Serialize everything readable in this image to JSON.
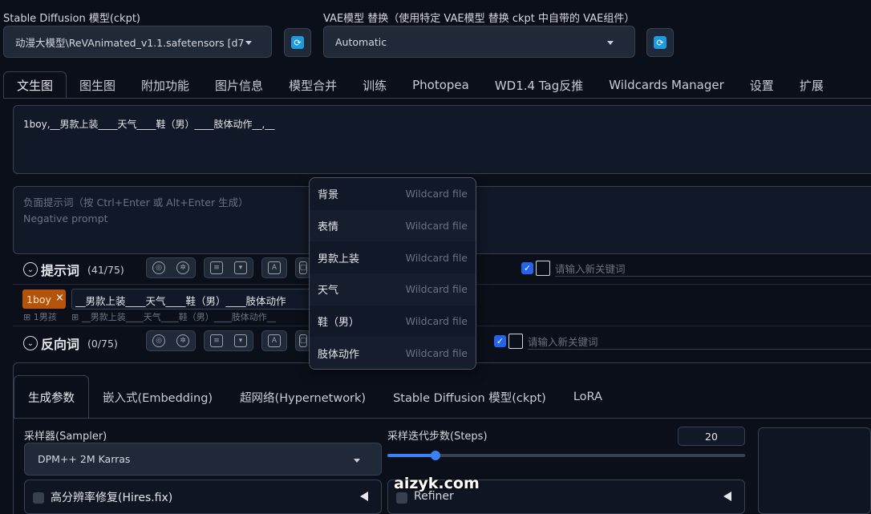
{
  "model": {
    "label": "Stable Diffusion 模型(ckpt)",
    "value": "动漫大模型\\ReVAnimated_v1.1.safetensors [d7"
  },
  "vae": {
    "label": "VAE模型 替换（使用特定 VAE模型 替换 ckpt 中自带的 VAE组件）",
    "value": "Automatic"
  },
  "tabs": [
    "文生图",
    "图生图",
    "附加功能",
    "图片信息",
    "模型合并",
    "训练",
    "Photopea",
    "WD1.4 Tag反推",
    "Wildcards Manager",
    "设置",
    "扩展"
  ],
  "prompt": {
    "text": "1boy,__男款上装____天气____鞋（男）____肢体动作__,__"
  },
  "negative": {
    "placeholder_line1": "负面提示词（按 Ctrl+Enter 或 Alt+Enter 生成）",
    "placeholder_line2": "Negative prompt"
  },
  "prompt_section": {
    "title": "提示词",
    "count": "(41/75)",
    "keyword_placeholder": "请输入新关键词"
  },
  "tag_row": {
    "tag": "1boy",
    "tag_close": "×",
    "tag_sub": "1男孩",
    "tag_text": "__男款上装____天气____鞋（男）____肢体动作",
    "tag_sub_text": "__男款上装____天气____鞋（男）____肢体动作__"
  },
  "negative_section": {
    "title": "反向词",
    "count": "(0/75)",
    "keyword_placeholder": "请输入新关键词"
  },
  "wildcard_menu": {
    "hint": "Wildcard file",
    "items": [
      "背景",
      "表情",
      "男款上装",
      "天气",
      "鞋（男）",
      "肢体动作"
    ]
  },
  "subtabs": [
    "生成参数",
    "嵌入式(Embedding)",
    "超网络(Hypernetwork)",
    "Stable Diffusion 模型(ckpt)",
    "LoRA"
  ],
  "sampler": {
    "label": "采样器(Sampler)",
    "value": "DPM++ 2M Karras"
  },
  "steps": {
    "label": "采样迭代步数(Steps)",
    "value": "20",
    "fraction": 0.135
  },
  "hires": {
    "label": "高分辨率修复(Hires.fix)"
  },
  "refiner": {
    "label": "Refiner"
  },
  "watermark": "aizyk.com",
  "colors": {
    "accent": "#2563eb",
    "tag": "#b45309",
    "refresh": "#1d9ae0"
  }
}
